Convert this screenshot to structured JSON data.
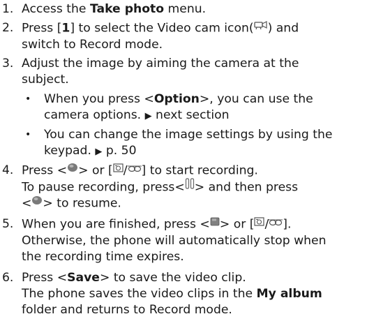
{
  "steps": [
    {
      "num": "1.",
      "pre": "Access the ",
      "bold": "Take photo",
      "post": " menu."
    },
    {
      "num": "2.",
      "l1_a": "Press [",
      "l1_key": "1",
      "l1_b": "] to select the Video cam icon(",
      "l1_c": ") and",
      "l2": "switch to Record mode."
    },
    {
      "num": "3.",
      "l1": "Adjust the image by aiming the camera at the",
      "l2": "subject."
    },
    {
      "num": "4.",
      "l1_a": "Press <",
      "l1_b": "> or [",
      "l1_c": "] to start recording.",
      "l2_a": "To pause recording, press<",
      "l2_b": "> and then press",
      "l3_a": "<",
      "l3_b": "> to resume."
    },
    {
      "num": "5.",
      "l1_a": "When you are finished, press <",
      "l1_b": "> or [",
      "l1_c": "].",
      "l2": "Otherwise, the phone will automatically stop when",
      "l3": "the recording time expires."
    },
    {
      "num": "6.",
      "l1_a": "Press <",
      "l1_bold": "Save",
      "l1_b": "> to save the video clip.",
      "l2_a": "The phone saves the video clips in the ",
      "l2_bold": "My album",
      "l3": "folder and returns to Record mode."
    }
  ],
  "bullets": [
    {
      "dot": "•",
      "l1_a": "When you press <",
      "l1_bold": "Option",
      "l1_b": ">, you can use the",
      "l2_a": "camera options. ",
      "l2_arrow": "▶",
      "l2_b": " next section"
    },
    {
      "dot": "•",
      "l1": "You can change the image settings by using the",
      "l2_a": "keypad. ",
      "l2_arrow": "▶",
      "l2_b": " p. 50"
    }
  ],
  "icons": {
    "video_cam": "video-cam-icon",
    "center_key": "center-key-icon",
    "camera_key": "camera-key-icon",
    "pause": "pause-icon",
    "stop": "stop-icon"
  },
  "camera_key_glyph": "/"
}
